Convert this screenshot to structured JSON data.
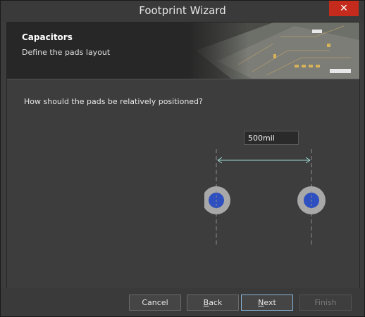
{
  "window": {
    "title": "Footprint Wizard",
    "close_glyph": "✕"
  },
  "header": {
    "title": "Capacitors",
    "subtitle": "Define the pads layout"
  },
  "main": {
    "question": "How should the pads be relatively positioned?",
    "spacing_value": "500mil"
  },
  "buttons": {
    "cancel": "Cancel",
    "back_mnemonic": "B",
    "back_rest": "ack",
    "next_mnemonic": "N",
    "next_rest": "ext",
    "finish": "Finish"
  },
  "colors": {
    "accent": "#8ab4d8",
    "pad_inner": "#2e4fbf",
    "pad_outer": "#a8a8a8",
    "dimension_line": "#9fd8d0",
    "close": "#c42b1c"
  }
}
